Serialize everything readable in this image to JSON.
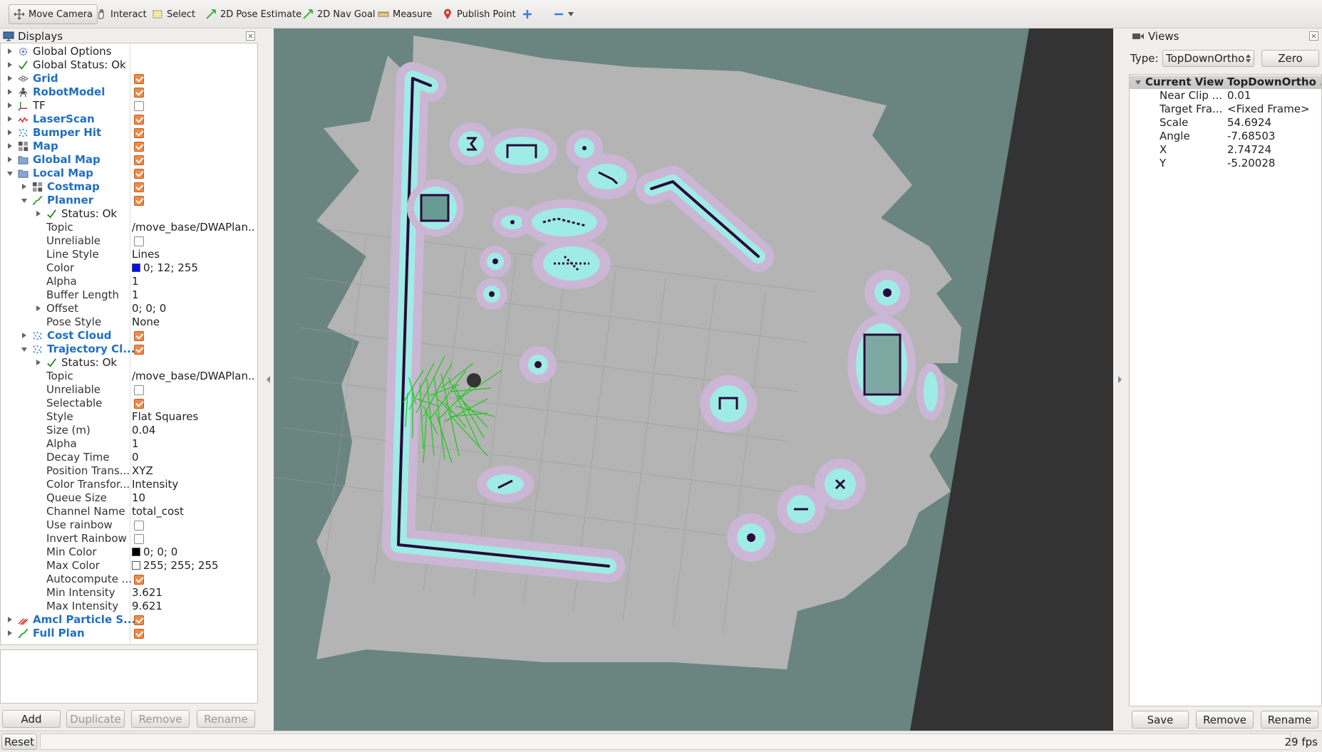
{
  "toolbar": {
    "tools": [
      {
        "label": "Move Camera",
        "icon": "move-camera-icon"
      },
      {
        "label": "Interact",
        "icon": "hand-icon"
      },
      {
        "label": "Select",
        "icon": "select-icon"
      },
      {
        "label": "2D Pose Estimate",
        "icon": "pose-arrow-icon"
      },
      {
        "label": "2D Nav Goal",
        "icon": "nav-goal-arrow-icon"
      },
      {
        "label": "Measure",
        "icon": "ruler-icon"
      },
      {
        "label": "Publish Point",
        "icon": "map-pin-icon"
      }
    ]
  },
  "displays_panel": {
    "title": "Displays",
    "rows": [
      {
        "label": "Global Options"
      },
      {
        "label": "Global Status: Ok"
      },
      {
        "label": "Grid"
      },
      {
        "label": "RobotModel"
      },
      {
        "label": "TF"
      },
      {
        "label": "LaserScan"
      },
      {
        "label": "Bumper Hit"
      },
      {
        "label": "Map"
      },
      {
        "label": "Global Map"
      },
      {
        "label": "Local Map"
      },
      {
        "label": "Costmap"
      },
      {
        "label": "Planner"
      },
      {
        "label": "Status: Ok"
      },
      {
        "label": "Topic",
        "value": "/move_base/DWAPlan..."
      },
      {
        "label": "Unreliable"
      },
      {
        "label": "Line Style",
        "value": "Lines"
      },
      {
        "label": "Color",
        "value": "0; 12; 255"
      },
      {
        "label": "Alpha",
        "value": "1"
      },
      {
        "label": "Buffer Length",
        "value": "1"
      },
      {
        "label": "Offset",
        "value": "0; 0; 0"
      },
      {
        "label": "Pose Style",
        "value": "None"
      },
      {
        "label": "Cost Cloud"
      },
      {
        "label": "Trajectory Cl..."
      },
      {
        "label": "Status: Ok"
      },
      {
        "label": "Topic",
        "value": "/move_base/DWAPlan..."
      },
      {
        "label": "Unreliable"
      },
      {
        "label": "Selectable"
      },
      {
        "label": "Style",
        "value": "Flat Squares"
      },
      {
        "label": "Size (m)",
        "value": "0.04"
      },
      {
        "label": "Alpha",
        "value": "1"
      },
      {
        "label": "Decay Time",
        "value": "0"
      },
      {
        "label": "Position Trans...",
        "value": "XYZ"
      },
      {
        "label": "Color Transfor...",
        "value": "Intensity"
      },
      {
        "label": "Queue Size",
        "value": "10"
      },
      {
        "label": "Channel Name",
        "value": "total_cost"
      },
      {
        "label": "Use rainbow"
      },
      {
        "label": "Invert Rainbow"
      },
      {
        "label": "Min Color",
        "value": "0; 0; 0"
      },
      {
        "label": "Max Color",
        "value": "255; 255; 255"
      },
      {
        "label": "Autocompute ..."
      },
      {
        "label": "Min Intensity",
        "value": "3.621"
      },
      {
        "label": "Max Intensity",
        "value": "9.621"
      },
      {
        "label": "Amcl Particle S..."
      },
      {
        "label": "Full Plan"
      }
    ],
    "buttons": {
      "add": "Add",
      "duplicate": "Duplicate",
      "remove": "Remove",
      "rename": "Rename"
    }
  },
  "views_panel": {
    "title": "Views",
    "type_label": "Type:",
    "type_value": "TopDownOrtho",
    "zero_button": "Zero",
    "header": {
      "name": "Current View",
      "value": "TopDownOrtho ..."
    },
    "props": [
      {
        "label": "Near Clip ...",
        "value": "0.01"
      },
      {
        "label": "Target Fra...",
        "value": "<Fixed Frame>"
      },
      {
        "label": "Scale",
        "value": "54.6924"
      },
      {
        "label": "Angle",
        "value": "-7.68503"
      },
      {
        "label": "X",
        "value": "2.74724"
      },
      {
        "label": "Y",
        "value": "-5.20028"
      }
    ],
    "buttons": {
      "save": "Save",
      "remove": "Remove",
      "rename": "Rename"
    }
  },
  "statusbar": {
    "reset": "Reset",
    "fps": "29 fps"
  },
  "colors": {
    "viewport_bg": "#6a8480",
    "map_free": "#b4b4b4",
    "obstacle": "#2a0a3a",
    "inflation_cyan": "#9fece6",
    "inflation_lilac": "#cbb6d6",
    "trajectory_green": "#22c922",
    "display_name_blue": "#1f6fc4",
    "checkbox_orange": "#ef8a4a",
    "planner_color": "#000cff"
  }
}
